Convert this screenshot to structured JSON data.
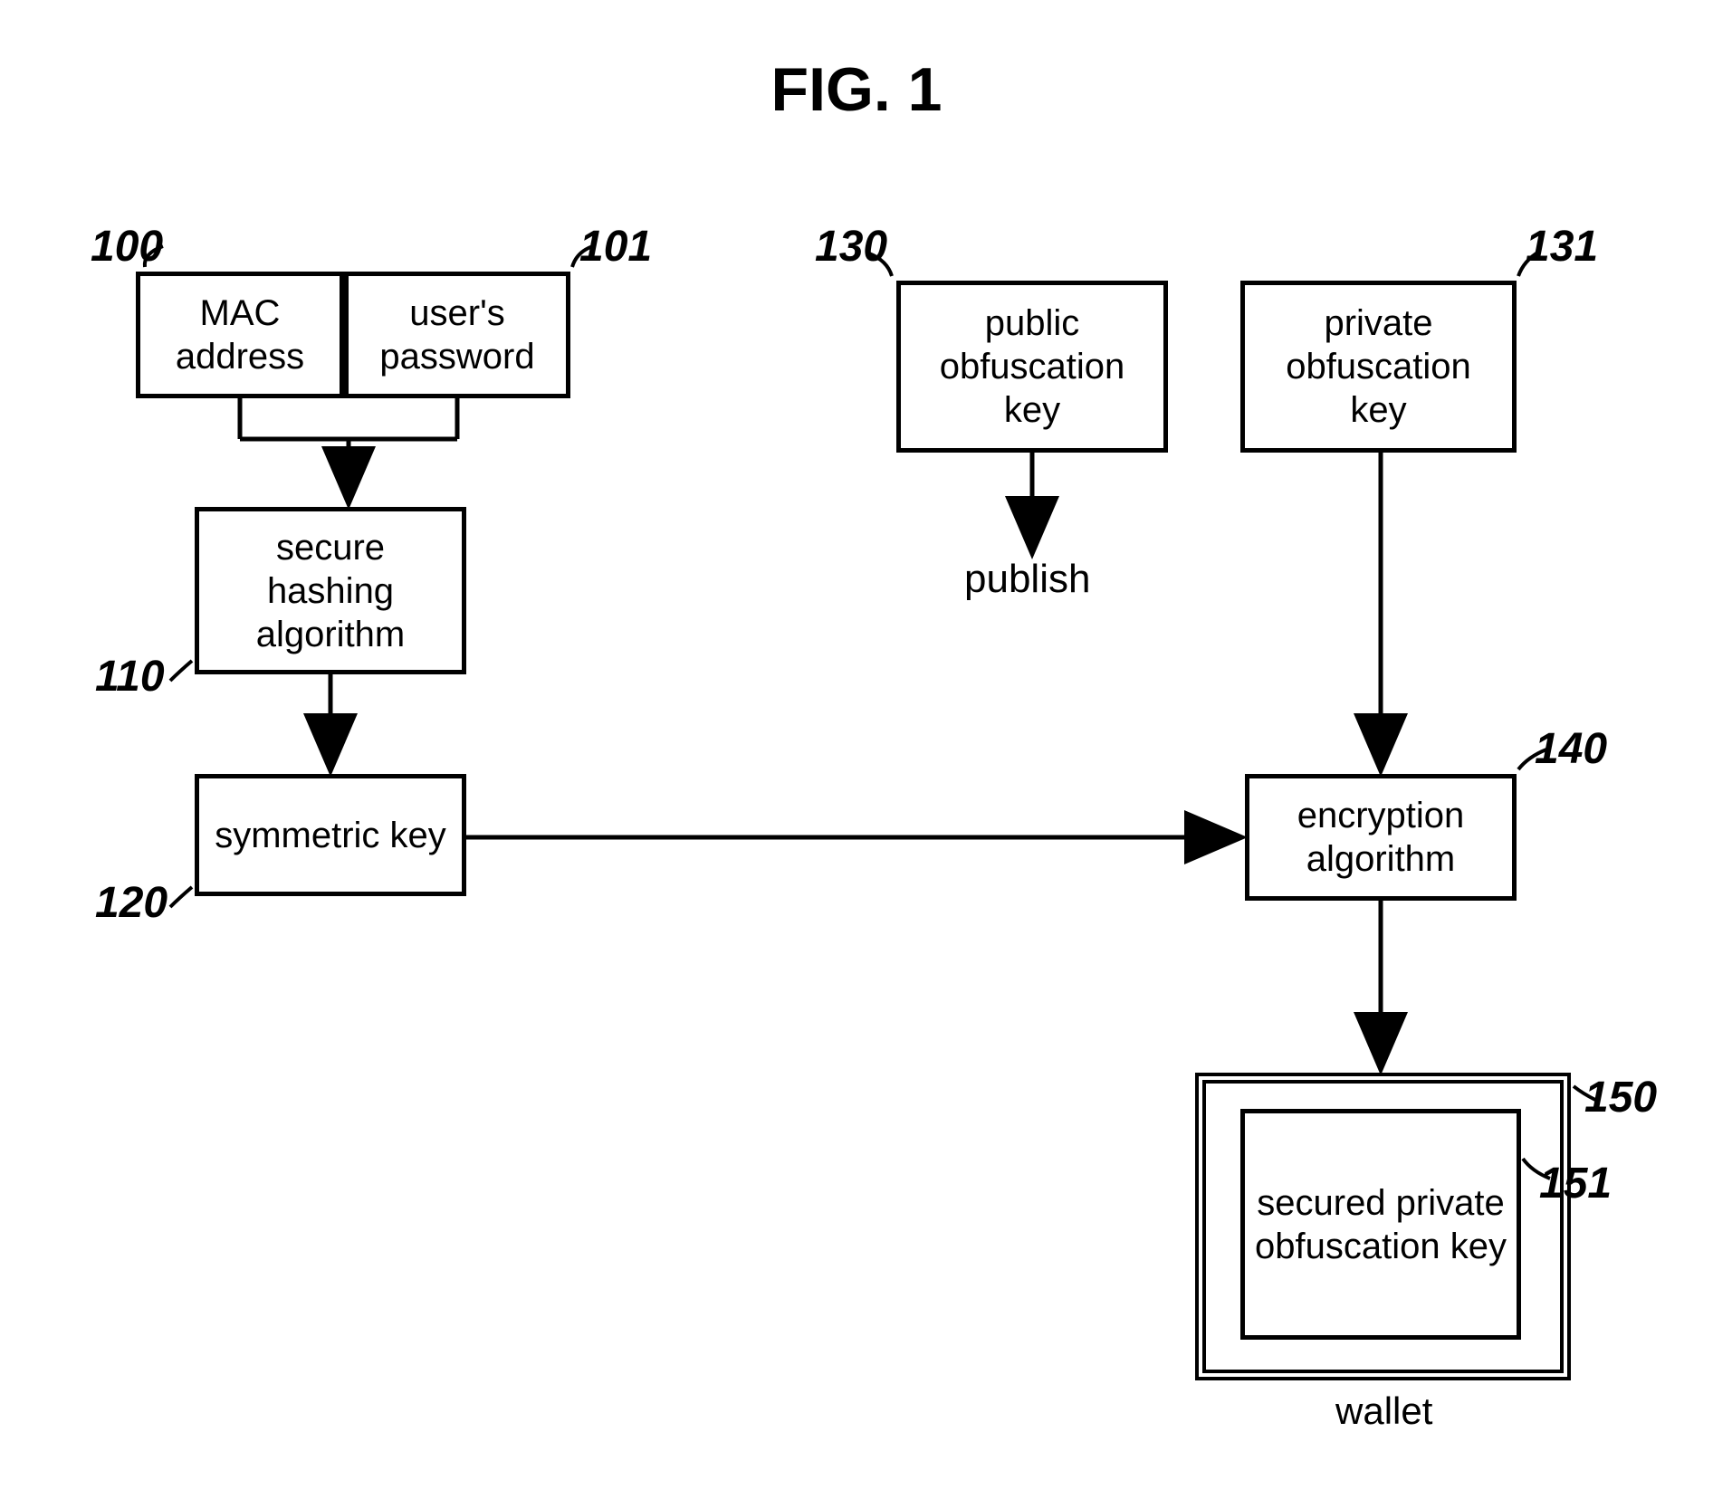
{
  "title": "FIG. 1",
  "boxes": {
    "mac_address": "MAC address",
    "users_password": "user's password",
    "secure_hashing": "secure hashing algorithm",
    "symmetric_key": "symmetric key",
    "public_obfuscation": "public obfuscation key",
    "private_obfuscation": "private obfuscation key",
    "encryption_algorithm": "encryption algorithm",
    "secured_private": "secured private obfuscation key"
  },
  "labels": {
    "ref_100": "100",
    "ref_101": "101",
    "ref_110": "110",
    "ref_120": "120",
    "ref_130": "130",
    "ref_131": "131",
    "ref_140": "140",
    "ref_150": "150",
    "ref_151": "151"
  },
  "text": {
    "publish": "publish",
    "wallet": "wallet"
  }
}
